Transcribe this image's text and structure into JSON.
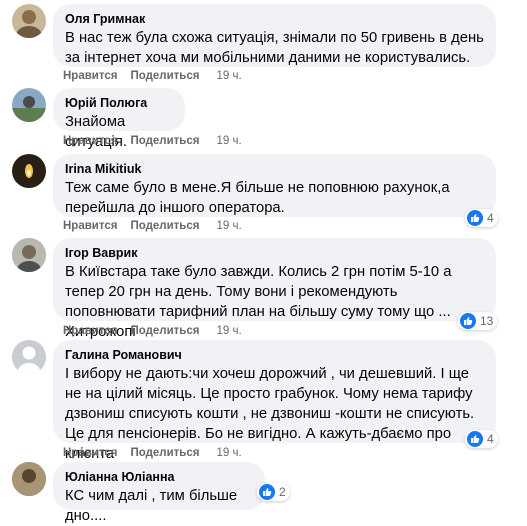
{
  "comments": [
    {
      "author": "Оля Гримнак",
      "text": "В нас теж була схожа ситуація, знімали по 50 гривень в день за інтернет хоча ми мобільними даними не користувались.",
      "like": "Нравится",
      "reply": "Поделиться",
      "time": "19 ч.",
      "avatar_color": "#c9b79a"
    },
    {
      "author": "Юрій Полюга",
      "text": "Знайома ситуація.",
      "like": "Нравится",
      "reply": "Поделиться",
      "time": "19 ч.",
      "avatar_color": "#8aa8c4"
    },
    {
      "author": "Irina Mikitiuk",
      "text": "Теж саме було в мене.Я більше не поповнюю рахунок,а перейшла до іншого оператора.",
      "like": "Нравится",
      "reply": "Поделиться",
      "time": "19 ч.",
      "reactions": "4",
      "avatar_color": "#2a1f14"
    },
    {
      "author": "Ігор Ваврик",
      "text": "В Київстара таке було завжди. Колись 2 грн потім 5-10 а тепер 20 грн на день. Тому вони і рекомендують поповнювати тарифний план на більшу суму тому що ... Хитрожопі",
      "like": "Нравится",
      "reply": "Поделиться",
      "time": "19 ч.",
      "reactions": "13",
      "avatar_color": "#9fa3a0"
    },
    {
      "author": "Галина Романович",
      "text": "І вибору не дають:чи хочеш дорожчий , чи дешевший. І ще не на цілий місяць. Це просто грабунок. Чому нема тарифу дзвониш списують кошти , не дзвониш -кошти не списують. Це для пенсіонерів. Бо не вигідно. А кажуть-дбаємо про клієнта",
      "like": "Нравится",
      "reply": "Поделиться",
      "time": "19 ч.",
      "reactions": "4",
      "avatar_color": "#c9ccd1"
    },
    {
      "author": "Юліанна Юліанна",
      "text": "КС чим далі , тим більше дно....",
      "reactions": "2",
      "avatar_color": "#8c7b5e"
    }
  ]
}
